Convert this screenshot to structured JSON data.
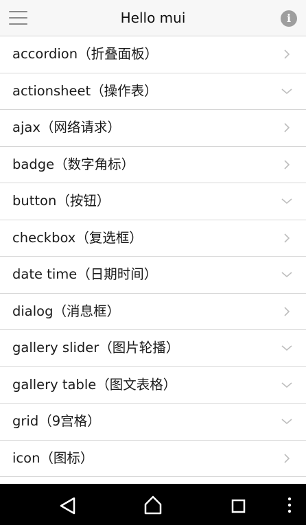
{
  "header": {
    "title": "Hello mui",
    "menu_icon": "hamburger-menu-icon",
    "info_icon": "info-icon",
    "info_glyph": "i"
  },
  "list": [
    {
      "label": "accordion（折叠面板）",
      "arrow": "chevron-right-icon"
    },
    {
      "label": "actionsheet（操作表）",
      "arrow": "chevron-down-icon"
    },
    {
      "label": "ajax（网络请求）",
      "arrow": "chevron-right-icon"
    },
    {
      "label": "badge（数字角标）",
      "arrow": "chevron-right-icon"
    },
    {
      "label": "button（按钮）",
      "arrow": "chevron-down-icon"
    },
    {
      "label": "checkbox（复选框）",
      "arrow": "chevron-right-icon"
    },
    {
      "label": "date time（日期时间）",
      "arrow": "chevron-down-icon"
    },
    {
      "label": "dialog（消息框）",
      "arrow": "chevron-right-icon"
    },
    {
      "label": "gallery slider（图片轮播）",
      "arrow": "chevron-down-icon"
    },
    {
      "label": "gallery table（图文表格）",
      "arrow": "chevron-down-icon"
    },
    {
      "label": "grid（9宫格）",
      "arrow": "chevron-down-icon"
    },
    {
      "label": "icon（图标）",
      "arrow": "chevron-right-icon"
    }
  ],
  "navbar": {
    "back_icon": "back-triangle-icon",
    "home_icon": "home-icon",
    "recents_icon": "recents-square-icon",
    "more_icon": "more-vertical-icon"
  },
  "colors": {
    "header_bg": "#f7f7f7",
    "divider": "#d6d6d6",
    "chevron": "#bdbdbd",
    "navbar_bg": "#000000"
  }
}
